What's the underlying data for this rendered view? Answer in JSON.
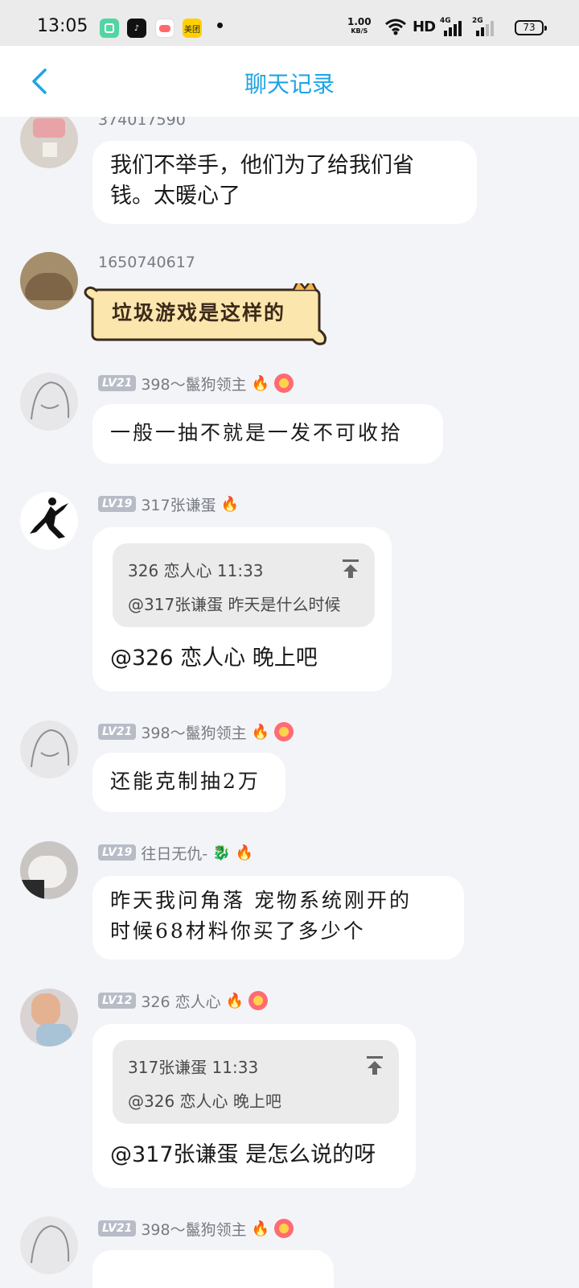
{
  "status_bar": {
    "time": "13:05",
    "apps": [
      {
        "name": "green-app",
        "label": "",
        "color": "#52d5a3"
      },
      {
        "name": "tiktok",
        "label": "♪",
        "color": "#111111"
      },
      {
        "name": "game-app",
        "label": "",
        "color": "#ff6b6b"
      },
      {
        "name": "meituan",
        "label": "美团",
        "color": "#ffd100"
      }
    ],
    "speed_value": "1.00",
    "speed_unit": "KB/S",
    "hd": "HD",
    "sig1": "4G",
    "sig2": "2G",
    "battery": "73"
  },
  "header": {
    "title": "聊天记录"
  },
  "messages": [
    {
      "sender": "374017590",
      "text_lines": [
        "我们不举手，他们为了给我们省",
        "钱。太暖心了"
      ]
    },
    {
      "sender": "1650740617",
      "sticker_text": "垃圾游戏是这样的"
    },
    {
      "level": "LV21",
      "sender": "398～鬣狗领主",
      "text": "一般一抽不就是一发不可收拾"
    },
    {
      "level": "LV19",
      "sender": "317张谦蛋",
      "quote_head": "326 恋人心 11:33",
      "quote_body": "@317张谦蛋 昨天是什么时候",
      "reply": "@326 恋人心 晚上吧"
    },
    {
      "level": "LV21",
      "sender": "398～鬣狗领主",
      "text": "还能克制抽2万"
    },
    {
      "level": "LV19",
      "sender": "往日无仇-",
      "text_lines": [
        "昨天我问角落  宠物系统刚开的",
        "时候68材料你买了多少个"
      ]
    },
    {
      "level": "LV12",
      "sender": "326 恋人心",
      "quote_head": "317张谦蛋 11:33",
      "quote_body": "@326 恋人心 晚上吧",
      "reply": "@317张谦蛋 是怎么说的呀"
    },
    {
      "level": "LV21",
      "sender": "398～鬣狗领主"
    }
  ],
  "colors": {
    "accent": "#1ea4e6",
    "background": "#f3f4f8",
    "level_badge": "#b7bcc7"
  }
}
